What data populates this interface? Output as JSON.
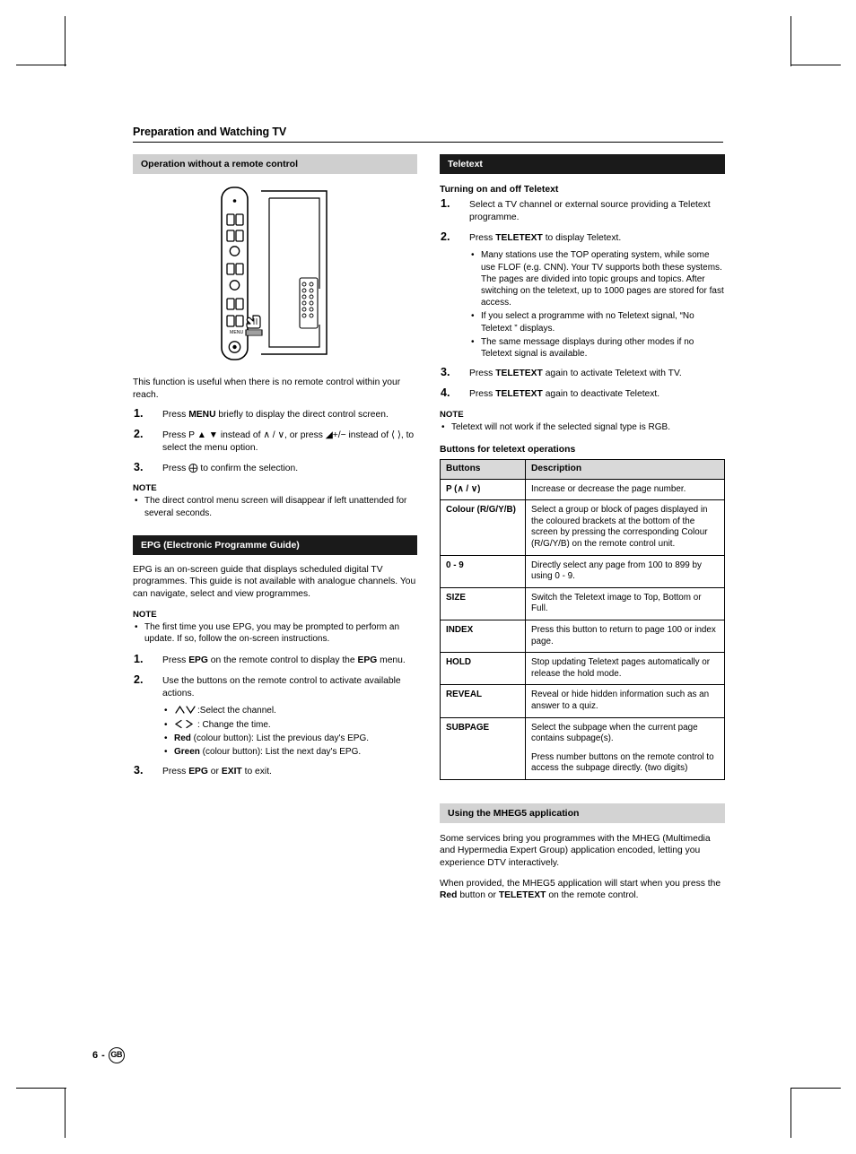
{
  "page": {
    "number": "6",
    "dash": "-",
    "region": "GB",
    "title": "Preparation and Watching TV"
  },
  "left": {
    "section1": {
      "heading": "Operation without a remote control"
    },
    "intro": "This function is useful when there is no remote control within your reach.",
    "steps": [
      {
        "num": "1.",
        "text_before": "Press ",
        "bold": "MENU",
        "text_after": " briefly to display the direct control screen."
      },
      {
        "num": "2.",
        "text": "Press P ▲ ▼ instead of ∧ / ∨, or press ◢+/− instead of ⟨ ⟩, to select the menu option."
      },
      {
        "num": "3.",
        "text": "Press ⨁ to confirm the selection."
      }
    ],
    "note_label": "NOTE",
    "note_item": "The direct control menu screen will disappear if left unattended for several seconds.",
    "section2": {
      "heading": "EPG (Electronic Programme Guide)"
    },
    "epg_intro": "EPG is an on-screen guide that displays scheduled digital TV programmes. This guide is not available with analogue channels. You can navigate, select and view programmes.",
    "epg_note_label": "NOTE",
    "epg_note_item": "The first time you use EPG, you may be prompted to perform an update. If so, follow the on-screen instructions.",
    "epg_steps": [
      {
        "num": "1.",
        "text_before": "Press ",
        "bold": "EPG",
        "text_mid": " on the remote control to display the ",
        "bold2": "EPG",
        "text_after": " menu."
      },
      {
        "num": "2.",
        "text": "Use the buttons on the remote control to activate available actions."
      },
      {
        "num": "3.",
        "text_before": "Press ",
        "bold": "EPG",
        "text_mid": " or ",
        "bold2": "EXIT",
        "text_after": " to exit."
      }
    ],
    "epg_bullets": [
      {
        "icon": "up-down-arrow-icon",
        "text": ":Select the channel."
      },
      {
        "icon": "left-right-arrow-icon",
        "text": ": Change the time."
      },
      {
        "bold": "Red",
        "text": " (colour button): List the previous day's EPG."
      },
      {
        "bold": "Green",
        "text": " (colour button): List the next day's EPG."
      }
    ],
    "illustration": {
      "name": "tv-side-panel-illustration",
      "menu_label": "MENU"
    }
  },
  "right": {
    "section_teletext": {
      "heading": "Teletext"
    },
    "sub1": "Turning on and off Teletext",
    "steps": [
      {
        "num": "1.",
        "text": "Select a TV channel or external source providing a Teletext programme."
      },
      {
        "num": "2.",
        "text_before": "Press ",
        "bold": "TELETEXT",
        "text_after": " to display Teletext."
      },
      {
        "num": "3.",
        "text_before": "Press ",
        "bold": "TELETEXT",
        "text_after": " again to activate Teletext with TV."
      },
      {
        "num": "4.",
        "text_before": "Press ",
        "bold": "TELETEXT",
        "text_after": " again to deactivate Teletext."
      }
    ],
    "step2_bullets": [
      "Many stations use the TOP operating system, while some use FLOF (e.g. CNN). Your TV supports both these systems. The pages are divided into topic groups and topics. After switching on the teletext, up to 1000 pages are stored for fast access.",
      "If you select a programme with no Teletext signal, “No Teletext ” displays.",
      "The same message displays during other modes if no Teletext signal is available."
    ],
    "note_label": "NOTE",
    "note_item": "Teletext will not work if the selected signal type is RGB.",
    "sub2": "Buttons for teletext operations",
    "table": {
      "headers": [
        "Buttons",
        "Description"
      ],
      "rows": [
        {
          "button": "P (∧ / ∨)",
          "desc": [
            "Increase or decrease the page number."
          ]
        },
        {
          "button": "Colour (R/G/Y/B)",
          "desc": [
            "Select a group or block of pages displayed in the coloured brackets at the bottom of the screen by pressing the corresponding Colour (R/G/Y/B) on the remote control unit."
          ]
        },
        {
          "button": "0 - 9",
          "desc": [
            "Directly select any page from 100 to 899 by using 0 - 9."
          ]
        },
        {
          "button": "SIZE",
          "desc": [
            "Switch the Teletext image to Top, Bottom or Full."
          ]
        },
        {
          "button": "INDEX",
          "desc": [
            "Press this button to return to page 100 or index page."
          ]
        },
        {
          "button": "HOLD",
          "desc": [
            "Stop updating Teletext pages automatically or release the hold mode."
          ]
        },
        {
          "button": "REVEAL",
          "desc": [
            "Reveal or hide hidden information such as an answer to a quiz."
          ]
        },
        {
          "button": "SUBPAGE",
          "desc": [
            "Select the subpage when the current page contains subpage(s).",
            "Press number buttons on the remote control to access the subpage directly. (two digits)"
          ]
        }
      ]
    },
    "section_mheg": {
      "heading": "Using the MHEG5 application"
    },
    "mheg_p1": "Some services bring you programmes with the MHEG (Multimedia and Hypermedia Expert Group) application encoded, letting you experience DTV interactively.",
    "mheg_p2_a": "When provided, the MHEG5 application will start when you press the ",
    "mheg_p2_bold1": "Red",
    "mheg_p2_b": " button or ",
    "mheg_p2_bold2": "TELETEXT",
    "mheg_p2_c": " on the remote control."
  }
}
